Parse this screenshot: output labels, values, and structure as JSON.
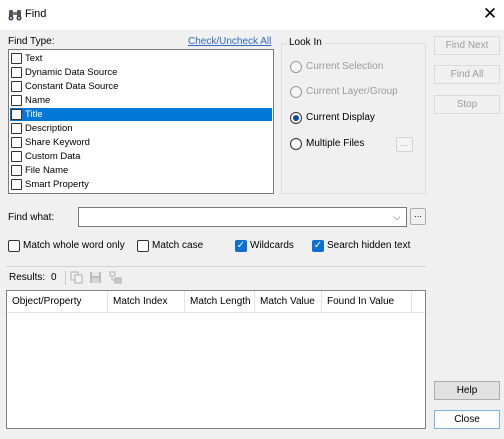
{
  "window": {
    "title": "Find",
    "close_icon": "close-icon",
    "app_icon": "binoculars-icon"
  },
  "find_type": {
    "label": "Find Type:",
    "toggle_link": "Check/Uncheck All",
    "items": [
      {
        "label": "Text",
        "checked": false,
        "selected": false
      },
      {
        "label": "Dynamic Data Source",
        "checked": false,
        "selected": false
      },
      {
        "label": "Constant Data Source",
        "checked": false,
        "selected": false
      },
      {
        "label": "Name",
        "checked": false,
        "selected": false
      },
      {
        "label": "Title",
        "checked": false,
        "selected": true
      },
      {
        "label": "Description",
        "checked": false,
        "selected": false
      },
      {
        "label": "Share Keyword",
        "checked": false,
        "selected": false
      },
      {
        "label": "Custom Data",
        "checked": false,
        "selected": false
      },
      {
        "label": "File Name",
        "checked": false,
        "selected": false
      },
      {
        "label": "Smart Property",
        "checked": false,
        "selected": false
      }
    ]
  },
  "look_in": {
    "label": "Look In",
    "options": [
      {
        "label": "Current Selection",
        "enabled": false,
        "selected": false
      },
      {
        "label": "Current Layer/Group",
        "enabled": false,
        "selected": false
      },
      {
        "label": "Current Display",
        "enabled": true,
        "selected": true
      },
      {
        "label": "Multiple Files",
        "enabled": true,
        "selected": false
      }
    ],
    "browse_label": "..."
  },
  "buttons": {
    "find_next": "Find Next",
    "find_all": "Find All",
    "stop": "Stop",
    "help": "Help",
    "close": "Close"
  },
  "find_what": {
    "label": "Find what:",
    "value": "",
    "dropdown_icon": "chevron-down-icon",
    "browse_label": "..."
  },
  "options": {
    "match_whole_word": {
      "label": "Match whole word only",
      "checked": false
    },
    "match_case": {
      "label": "Match case",
      "checked": false
    },
    "wildcards": {
      "label": "Wildcards",
      "checked": true
    },
    "search_hidden": {
      "label": "Search hidden text",
      "checked": true
    }
  },
  "results": {
    "label": "Results:",
    "count": "0",
    "toolbar_icons": [
      "copy-icon",
      "save-icon",
      "select-objects-icon"
    ],
    "columns": [
      "Object/Property",
      "Match Index",
      "Match Length",
      "Match Value",
      "Found In Value"
    ],
    "rows": []
  },
  "colors": {
    "selection": "#0078d7",
    "link": "#2e6bc6",
    "check_on": "#0b6fd3"
  }
}
